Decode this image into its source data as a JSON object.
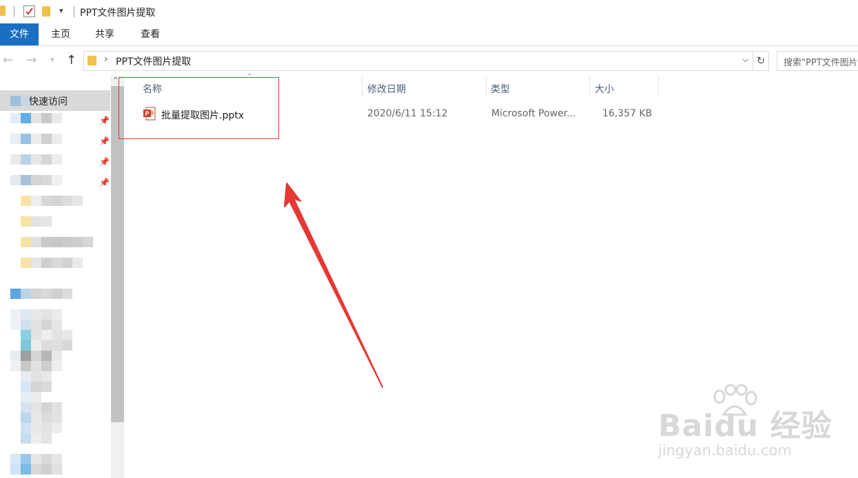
{
  "window": {
    "title": "PPT文件图片提取"
  },
  "ribbon": {
    "tabs": [
      "文件",
      "主页",
      "共享",
      "查看"
    ]
  },
  "address": {
    "path": "PPT文件图片提取",
    "search_placeholder": "搜索\"PPT文件图片提取\""
  },
  "nav_pane": {
    "quick_access_label": "快速访问"
  },
  "columns": {
    "name": "名称",
    "modified": "修改日期",
    "type": "类型",
    "size": "大小"
  },
  "files": [
    {
      "name": "批量提取图片.pptx",
      "modified": "2020/6/11 15:12",
      "type": "Microsoft Power...",
      "size": "16,357 KB"
    }
  ],
  "watermark": {
    "brand": "Baidu 经验",
    "url": "jingyan.baidu.com"
  },
  "colors": {
    "accent": "#1a6fc2",
    "highlight": "#d9393a",
    "arrow": "#e53935"
  },
  "icons": {
    "folder": "folder-icon",
    "ppt": "powerpoint-file-icon",
    "pin": "pin-icon",
    "up": "up-arrow-icon",
    "refresh": "refresh-icon"
  }
}
